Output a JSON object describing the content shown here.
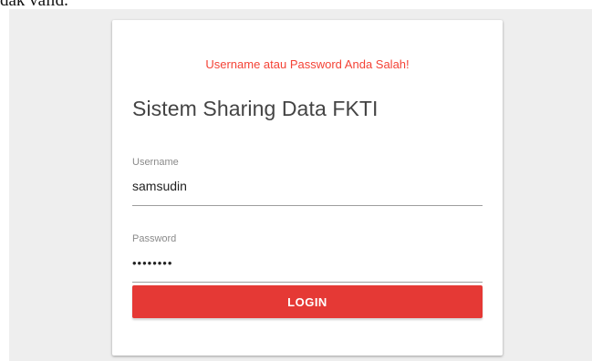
{
  "caption": "dak valid.",
  "login_form": {
    "error_message": "Username atau Password Anda Salah!",
    "title": "Sistem Sharing Data FKTI",
    "username": {
      "label": "Username",
      "value": "samsudin"
    },
    "password": {
      "label": "Password",
      "value": "••••••••"
    },
    "login_button": "LOGIN"
  },
  "colors": {
    "error": "#f44336",
    "button": "#e53935",
    "backdrop": "#eeeeee"
  }
}
